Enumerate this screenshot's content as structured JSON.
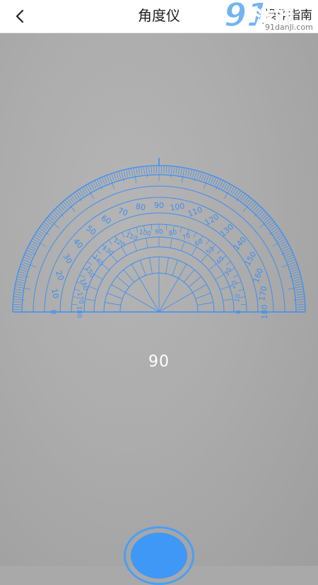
{
  "header": {
    "title": "角度仪",
    "help_label": "操作指南",
    "back_icon": "chevron-left-icon"
  },
  "watermark": {
    "number": "91",
    "brand": "游戏",
    "url": "91danji.com"
  },
  "protractor": {
    "color": "#3d8ff0",
    "outer_labels": [
      "0",
      "10",
      "20",
      "30",
      "40",
      "50",
      "60",
      "70",
      "80",
      "90",
      "100",
      "110",
      "120",
      "130",
      "140",
      "150",
      "160",
      "170",
      "180"
    ],
    "inner_labels": [
      "180",
      "170",
      "160",
      "150",
      "140",
      "130",
      "120",
      "110",
      "100",
      "90",
      "80",
      "70",
      "60",
      "50",
      "40",
      "30",
      "20",
      "10",
      "0"
    ]
  },
  "reading": {
    "angle": "90"
  },
  "shutter": {
    "color": "#3f97f6",
    "icon": "shutter-button-icon"
  }
}
